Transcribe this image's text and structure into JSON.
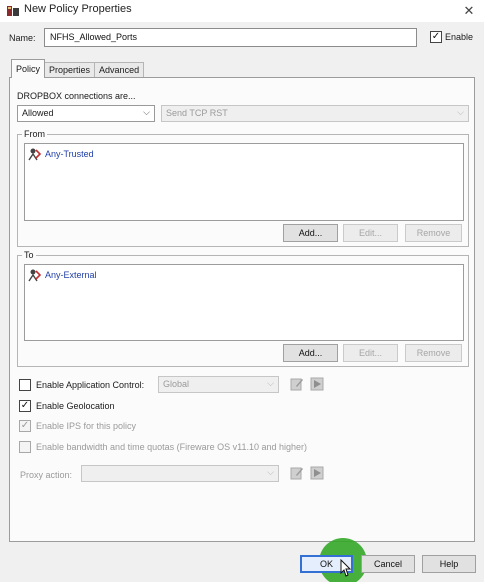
{
  "window": {
    "title": "New Policy Properties",
    "close": "✕"
  },
  "name_row": {
    "label": "Name:",
    "value": "NFHS_Allowed_Ports",
    "enable_label": "Enable",
    "enable_checked": true
  },
  "tabs": [
    {
      "label": "Policy"
    },
    {
      "label": "Properties"
    },
    {
      "label": "Advanced"
    }
  ],
  "connections": {
    "label": "DROPBOX connections are...",
    "action": "Allowed",
    "deny_option": "Send TCP RST"
  },
  "from": {
    "title": "From",
    "entries": [
      "Any-Trusted"
    ]
  },
  "to": {
    "title": "To",
    "entries": [
      "Any-External"
    ]
  },
  "list_buttons": {
    "add": "Add...",
    "edit": "Edit...",
    "remove": "Remove"
  },
  "app_control": {
    "label": "Enable Application Control:",
    "checked": false,
    "value": "Global"
  },
  "geolocation": {
    "label": "Enable Geolocation",
    "checked": true
  },
  "ips": {
    "label": "Enable IPS for this policy",
    "checked": true
  },
  "bandwidth": {
    "label": "Enable bandwidth and time quotas (Fireware OS v11.10 and higher)",
    "checked": false
  },
  "proxy": {
    "label": "Proxy action:",
    "value": ""
  },
  "footer": {
    "ok": "OK",
    "cancel": "Cancel",
    "help": "Help"
  },
  "colors": {
    "accent": "#3470d4",
    "link": "#1f3fa6",
    "highlight": "#34a828"
  },
  "icons": {
    "app": "firewall-policy-icon",
    "alias": "network-alias-icon",
    "edit": "edit-icon",
    "new": "new-action-icon"
  }
}
